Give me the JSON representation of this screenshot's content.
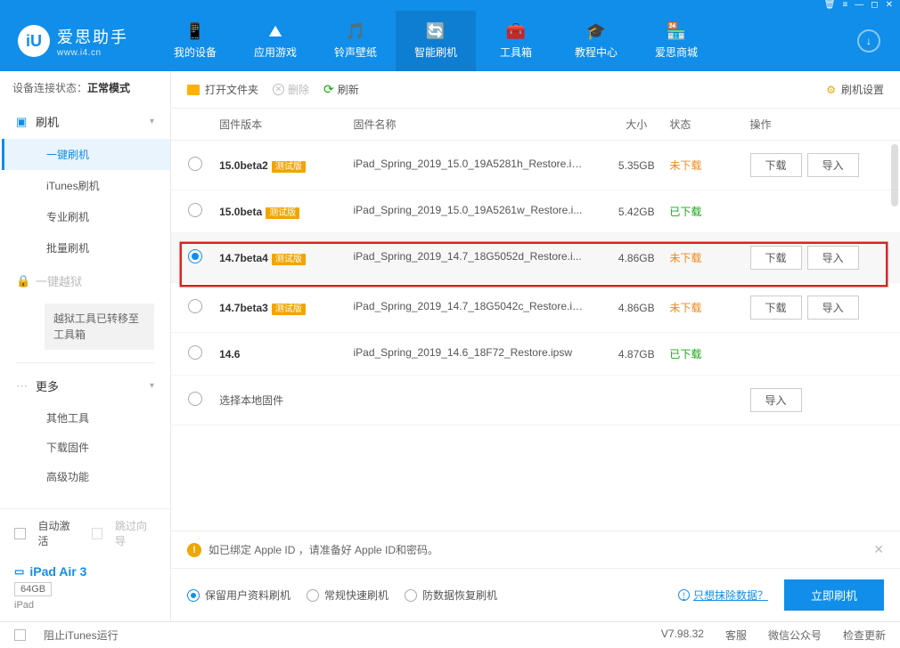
{
  "brand": {
    "zh": "爱思助手",
    "en": "www.i4.cn"
  },
  "nav": [
    {
      "icon": "📱",
      "label": "我的设备"
    },
    {
      "icon": "⛰",
      "label": "应用游戏"
    },
    {
      "icon": "🎵",
      "label": "铃声壁纸"
    },
    {
      "icon": "🔄",
      "label": "智能刷机"
    },
    {
      "icon": "🧰",
      "label": "工具箱"
    },
    {
      "icon": "🎓",
      "label": "教程中心"
    },
    {
      "icon": "🏪",
      "label": "爱思商城"
    }
  ],
  "conn": {
    "prefix": "设备连接状态：",
    "mode": "正常模式"
  },
  "sidebar": {
    "flash": {
      "hdr": "刷机",
      "items": [
        "一键刷机",
        "iTunes刷机",
        "专业刷机",
        "批量刷机"
      ]
    },
    "jail": {
      "hdr": "一键越狱",
      "note": "越狱工具已转移至工具箱"
    },
    "more": {
      "hdr": "更多",
      "items": [
        "其他工具",
        "下载固件",
        "高级功能"
      ]
    }
  },
  "sb_footer": {
    "auto": "自动激活",
    "skip": "跳过向导"
  },
  "device": {
    "name": "iPad Air 3",
    "cap": "64GB",
    "type": "iPad"
  },
  "toolbar": {
    "open": "打开文件夹",
    "del": "删除",
    "refresh": "刷新",
    "settings": "刷机设置"
  },
  "columns": {
    "ver": "固件版本",
    "name": "固件名称",
    "size": "大小",
    "status": "状态",
    "ops": "操作"
  },
  "rows": [
    {
      "ver": "15.0beta2",
      "tag": "测试版",
      "name": "iPad_Spring_2019_15.0_19A5281h_Restore.ip...",
      "size": "5.35GB",
      "status": "未下载",
      "status_cls": "st-not",
      "dl": true,
      "imp": true,
      "sel": false
    },
    {
      "ver": "15.0beta",
      "tag": "测试版",
      "name": "iPad_Spring_2019_15.0_19A5261w_Restore.i...",
      "size": "5.42GB",
      "status": "已下载",
      "status_cls": "st-ok",
      "dl": false,
      "imp": false,
      "sel": false
    },
    {
      "ver": "14.7beta4",
      "tag": "测试版",
      "name": "iPad_Spring_2019_14.7_18G5052d_Restore.i...",
      "size": "4.86GB",
      "status": "未下载",
      "status_cls": "st-not",
      "dl": true,
      "imp": true,
      "sel": true
    },
    {
      "ver": "14.7beta3",
      "tag": "测试版",
      "name": "iPad_Spring_2019_14.7_18G5042c_Restore.ip...",
      "size": "4.86GB",
      "status": "未下载",
      "status_cls": "st-not",
      "dl": true,
      "imp": true,
      "sel": false
    },
    {
      "ver": "14.6",
      "tag": "",
      "name": "iPad_Spring_2019_14.6_18F72_Restore.ipsw",
      "size": "4.87GB",
      "status": "已下载",
      "status_cls": "st-ok",
      "dl": false,
      "imp": false,
      "sel": false
    }
  ],
  "local_row": "选择本地固件",
  "btns": {
    "download": "下载",
    "import": "导入"
  },
  "notice": "如已绑定 Apple ID ，请准备好 Apple ID和密码。",
  "flash_opts": [
    "保留用户资料刷机",
    "常规快速刷机",
    "防数据恢复刷机"
  ],
  "erase_link": "只想抹除数据？",
  "flash_btn": "立即刷机",
  "status": {
    "block": "阻止iTunes运行",
    "ver": "V7.98.32",
    "cs": "客服",
    "wx": "微信公众号",
    "upd": "检查更新"
  }
}
